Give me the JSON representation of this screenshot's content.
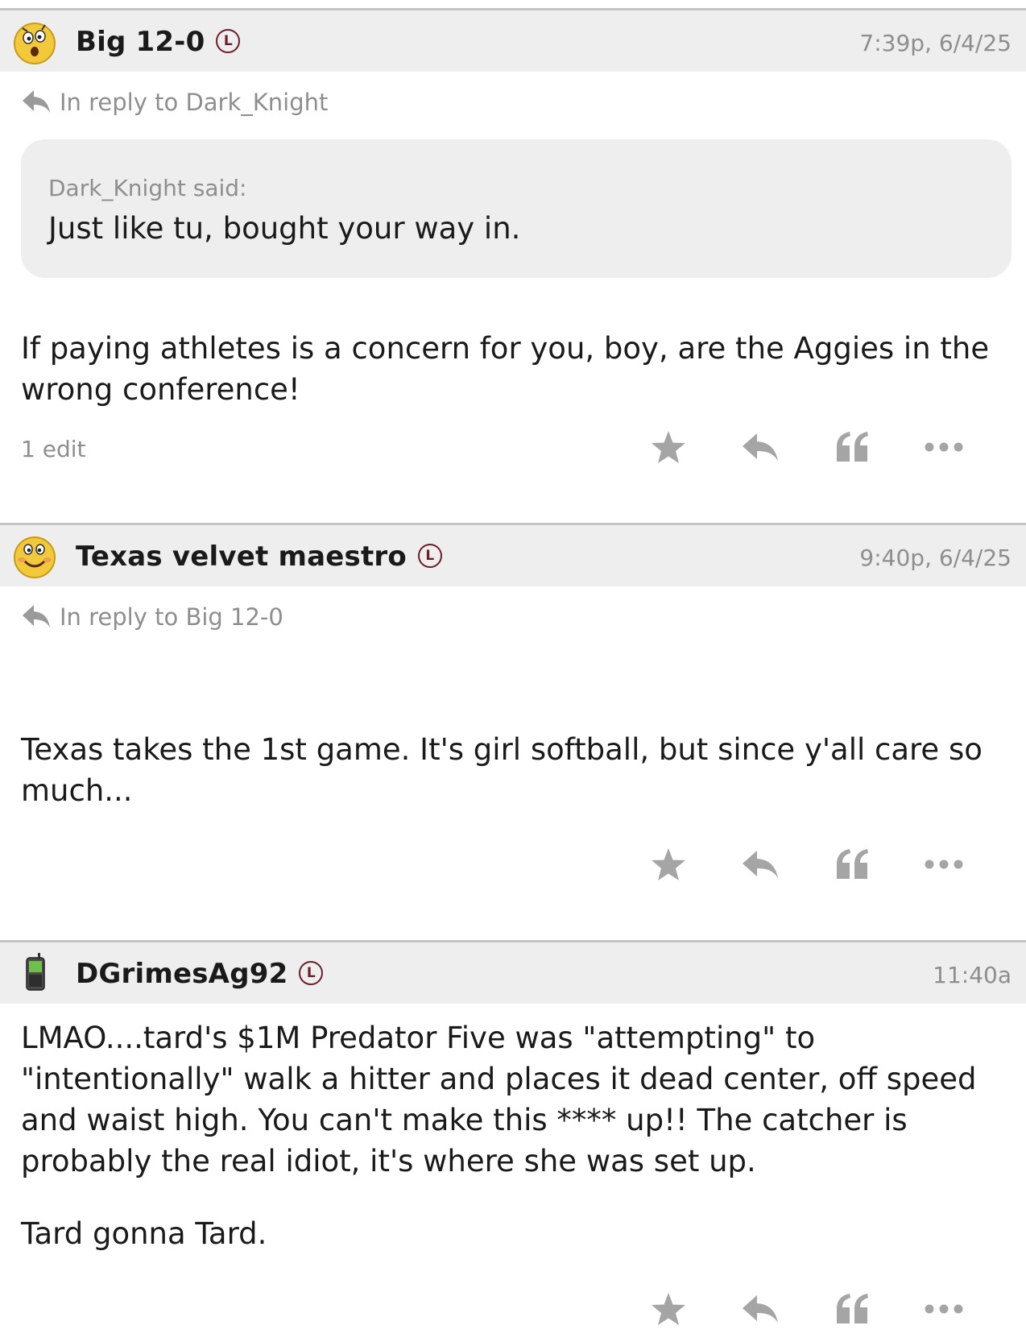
{
  "posts": [
    {
      "username": "Big 12-0",
      "badge": "L",
      "timestamp": "7:39p, 6/4/25",
      "in_reply_to": "In reply to Dark_Knight",
      "quote": {
        "author_said": "Dark_Knight said:",
        "text": "Just like tu, bought your way in."
      },
      "body": "If paying athletes is a concern for you, boy, are the Aggies in the wrong conference!",
      "edits": "1 edit",
      "avatar_icon": "surprised-face-icon"
    },
    {
      "username": "Texas velvet maestro",
      "badge": "L",
      "timestamp": "9:40p, 6/4/25",
      "in_reply_to": "In reply to Big 12-0",
      "body": "Texas takes the 1st game. It's girl softball, but since y'all care so much...",
      "avatar_icon": "smiley-face-icon"
    },
    {
      "username": "DGrimesAg92",
      "badge": "L",
      "timestamp": "11:40a",
      "body_paragraph_1": "LMAO....tard's $1M Predator Five was \"attempting\" to \"intentionally\" walk a hitter and places it dead center, off speed and waist high. You can't make this **** up!! The catcher is probably the real idiot, it's where she was set up.",
      "body_paragraph_2": "Tard gonna Tard.",
      "avatar_icon": "mobile-phone-icon"
    }
  ],
  "colors": {
    "accent": "#6b1e2a",
    "muted": "#8e8e8e",
    "header_bg": "#eeeeee"
  }
}
